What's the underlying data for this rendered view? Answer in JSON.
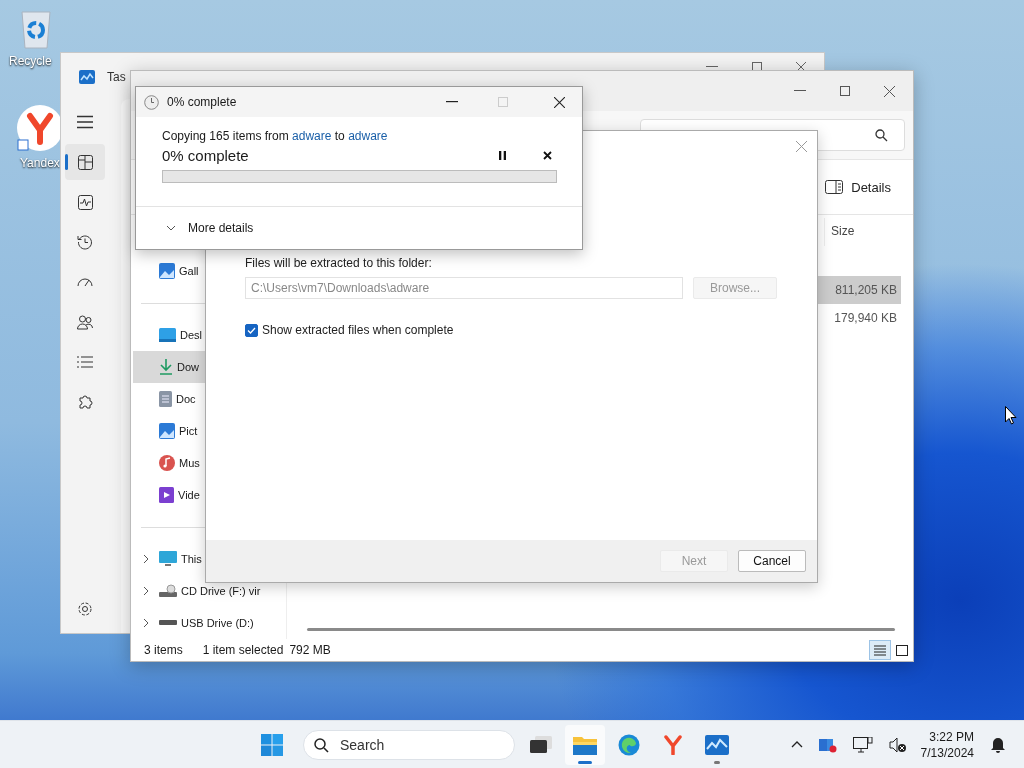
{
  "desktop_icons": [
    {
      "kind": "recycle",
      "label": "Recycle"
    },
    {
      "kind": "yandex",
      "label": "Yandex"
    }
  ],
  "task_manager": {
    "title": "Tas",
    "nav": [
      {
        "kind": "menu",
        "selected": false
      },
      {
        "kind": "processes",
        "selected": true
      },
      {
        "kind": "performance",
        "selected": false
      },
      {
        "kind": "history",
        "selected": false
      },
      {
        "kind": "startup",
        "selected": false
      },
      {
        "kind": "users",
        "selected": false
      },
      {
        "kind": "details",
        "selected": false
      },
      {
        "kind": "services",
        "selected": false
      },
      {
        "kind": "settings",
        "selected": false
      }
    ]
  },
  "explorer": {
    "details_button": "Details",
    "columns": [
      "Size"
    ],
    "rows": [
      {
        "size": "811,205 KB",
        "selected": true
      },
      {
        "size": "179,940 KB",
        "selected": false
      }
    ],
    "nav_groups": [
      [
        {
          "kind": "gallery",
          "label": "Gall",
          "selected": false
        }
      ],
      [
        {
          "kind": "desktop",
          "label": "Desl",
          "selected": false
        },
        {
          "kind": "downloads",
          "label": "Dow",
          "selected": true
        },
        {
          "kind": "documents",
          "label": "Doc",
          "selected": false
        },
        {
          "kind": "pictures",
          "label": "Pict",
          "selected": false
        },
        {
          "kind": "music",
          "label": "Mus",
          "selected": false
        },
        {
          "kind": "videos",
          "label": "Vide",
          "selected": false
        }
      ],
      [
        {
          "kind": "pc",
          "label": "This",
          "selected": false,
          "expanded": false
        },
        {
          "kind": "cd",
          "label": "CD Drive (F:) vir",
          "selected": false,
          "expanded": false
        },
        {
          "kind": "usb",
          "label": "USB Drive (D:)",
          "selected": false,
          "expanded": false
        }
      ]
    ],
    "status": {
      "count": "3 items",
      "selection": "1 item selected",
      "size": "792 MB"
    },
    "views": [
      {
        "kind": "details",
        "selected": true
      },
      {
        "kind": "tiles",
        "selected": false
      }
    ]
  },
  "extract_dialog": {
    "folder_label": "Files will be extracted to this folder:",
    "path": "C:\\Users\\vm7\\Downloads\\adware",
    "browse": {
      "label": "Browse...",
      "disabled": true
    },
    "show_files": {
      "label": "Show extracted files when complete",
      "checked": true
    },
    "buttons": [
      {
        "label": "Next",
        "disabled": true
      },
      {
        "label": "Cancel",
        "disabled": false
      }
    ]
  },
  "copy_dialog": {
    "title": "0% complete",
    "message": [
      {
        "kind": "text",
        "text": "Copying 165 items from"
      },
      {
        "kind": "link",
        "text": "adware"
      },
      {
        "kind": "text",
        "text": "to"
      },
      {
        "kind": "link",
        "text": "adware"
      }
    ],
    "heading": "0% complete",
    "level": 0,
    "more": "More details",
    "expanded": false
  },
  "taskbar": {
    "search_placeholder": "Search",
    "apps": [
      {
        "kind": "taskview",
        "running": false,
        "active": false
      },
      {
        "kind": "explorer",
        "running": true,
        "active": true
      },
      {
        "kind": "edge",
        "running": false,
        "active": false
      },
      {
        "kind": "yandex",
        "running": false,
        "active": false
      },
      {
        "kind": "taskmgr",
        "running": true,
        "active": false
      }
    ],
    "time": "3:22 PM",
    "date": "7/13/2024"
  }
}
